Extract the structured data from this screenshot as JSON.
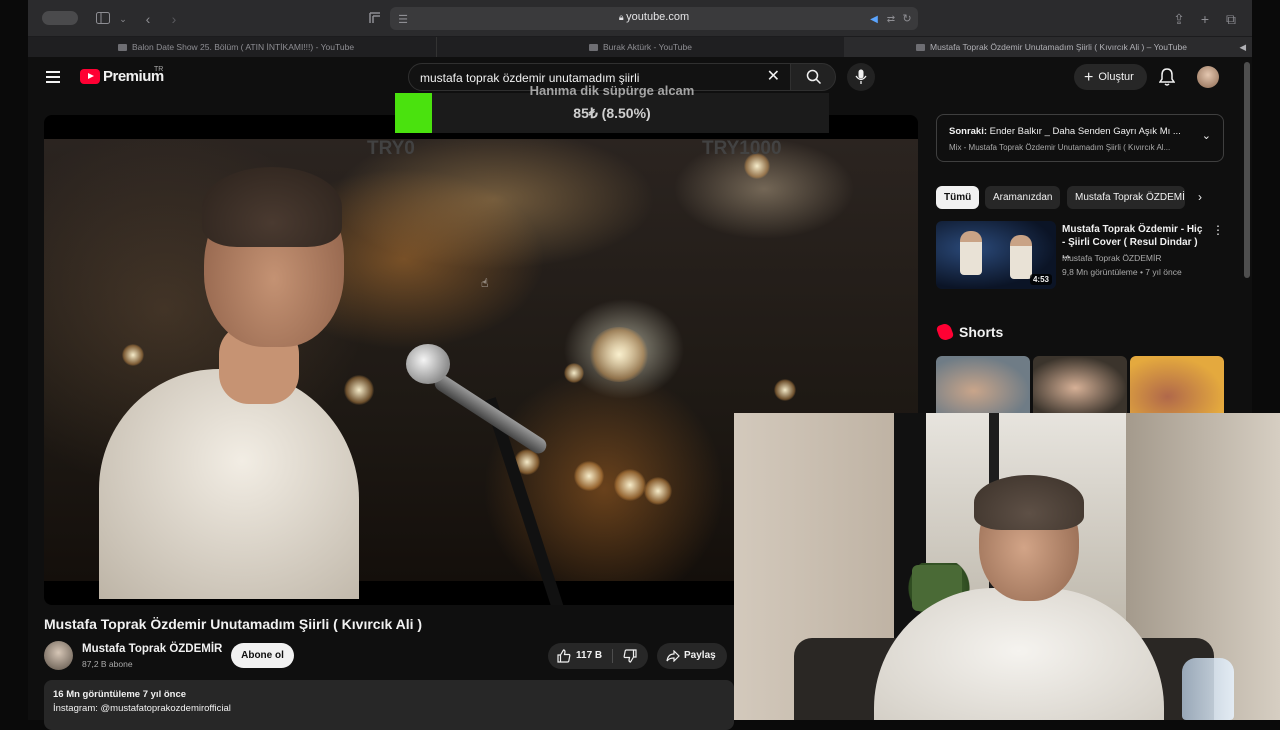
{
  "browser": {
    "url": "youtube.com",
    "tabs": [
      {
        "title": "Balon Date Show 25. Bölüm ( ATIN İNTİKAMI!!!) - YouTube",
        "active": false
      },
      {
        "title": "Burak Aktürk - YouTube",
        "active": false
      },
      {
        "title": "Mustafa Toprak Özdemir Unutamadım Şiirli ( Kıvırcık Ali ) – YouTube",
        "active": true
      }
    ]
  },
  "masthead": {
    "logo_text": "Premium",
    "region": "TR",
    "search_value": "mustafa toprak özdemir unutamadım şiirli",
    "create_label": "Oluştur"
  },
  "overlay": {
    "donation_message": "Hanıma dik süpürge alcam",
    "amount_text": "85₺ (8.50%)",
    "progress_fraction": 0.085,
    "start_label": "TRY0",
    "goal_label": "TRY1000",
    "fill_color": "#4ae20e"
  },
  "video": {
    "title": "Mustafa Toprak Özdemir Unutamadım Şiirli ( Kıvırcık Ali )",
    "channel_name": "Mustafa Toprak ÖZDEMİR",
    "subscribers": "87,2 B abone",
    "subscribe_label": "Abone ol",
    "likes": "117 B",
    "share_label": "Paylaş",
    "views_and_age": "16 Mn görüntüleme  7 yıl önce",
    "description_line1": "İnstagram: @mustafatoprakozdemirofficial"
  },
  "sidebar": {
    "next_label": "Sonraki:",
    "next_title": "Ender Balkır _ Daha Senden Gayrı Aşık Mı ...",
    "next_subtitle": "Mix - Mustafa Toprak Özdemir Unutamadım Şiirli ( Kıvırcık Al...",
    "chips": [
      "Tümü",
      "Aramanızdan",
      "Mustafa Toprak ÖZDEMİR"
    ],
    "recommendation": {
      "title": "Mustafa Toprak Özdemir - Hiç - Şiirli Cover  (  Resul Dindar ) ...",
      "channel": "Mustafa Toprak ÖZDEMİR",
      "meta": "9,8 Mn görüntüleme • 7 yıl önce",
      "duration": "4:53"
    },
    "shorts_label": "Shorts"
  },
  "colors": {
    "accent": "#ff0033",
    "background": "#0f0f0f"
  }
}
